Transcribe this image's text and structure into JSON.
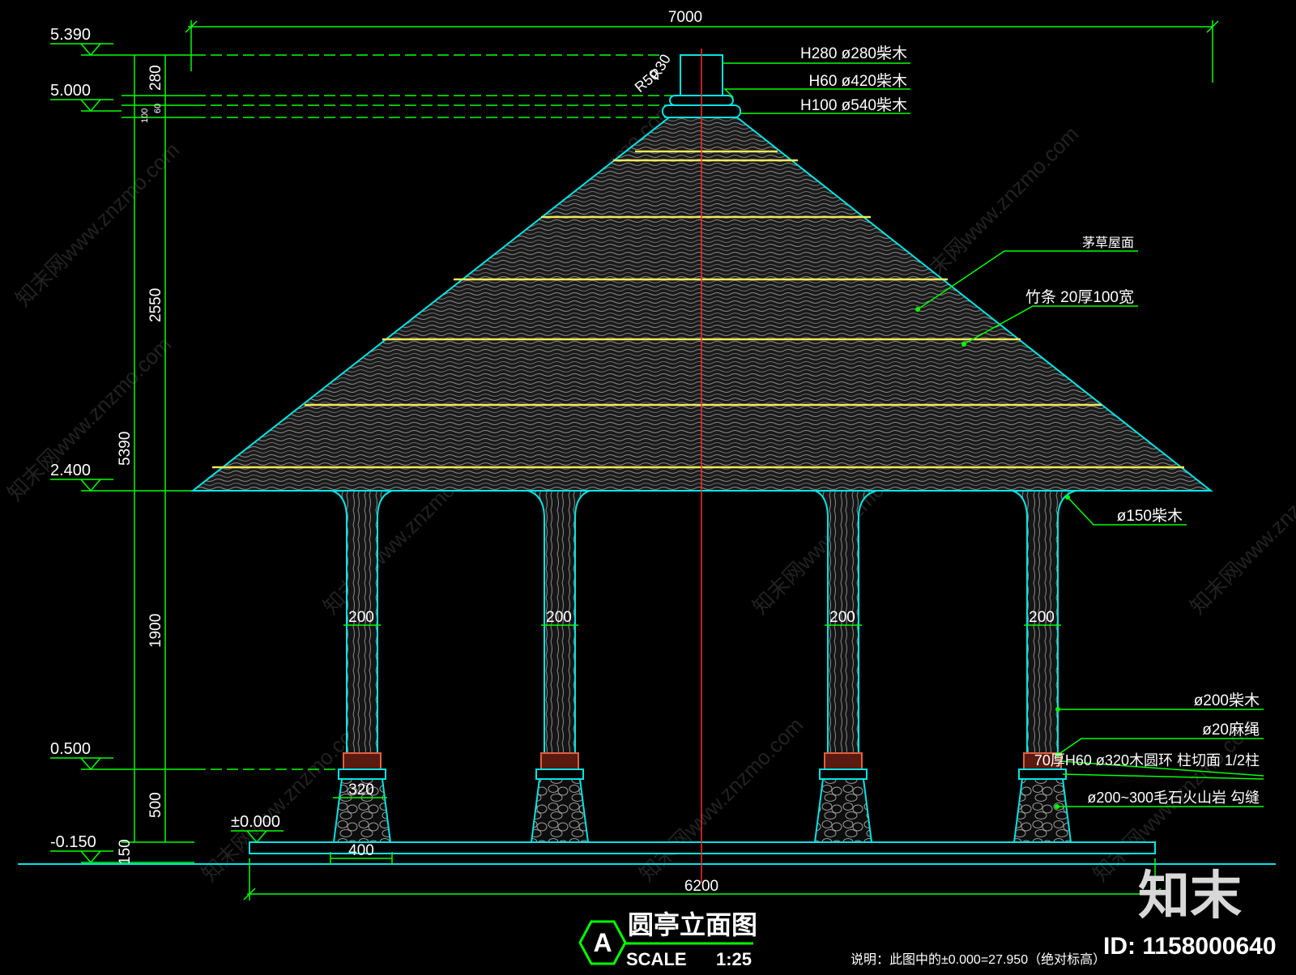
{
  "drawing": {
    "title": "圆亭立面图",
    "badge_letter": "A",
    "scale_label": "SCALE",
    "scale_value": "1:25",
    "note": "说明：此图中的±0.000=27.950（绝对标高）"
  },
  "dimensions": {
    "top_width": "7000",
    "bottom_width": "6200",
    "total_height": "5390",
    "roof_height": "2550",
    "column_height": "1900",
    "base_height": "500",
    "floor_thickness": "150",
    "cap_280": "280",
    "cap_60": "60",
    "cap_100": "100",
    "base_width": "400",
    "ring_width": "320",
    "column_dia": "200",
    "radius_r30": "R30",
    "radius_r50": "R50"
  },
  "elevations": [
    "5.390",
    "5.000",
    "2.400",
    "0.500",
    "±0.000",
    "-0.150"
  ],
  "annotations": {
    "cap_top": "H280  ø280柴木",
    "cap_mid": "H60  ø420柴木",
    "cap_bottom": "H100  ø540柴木",
    "roof_surface": "茅草屋面",
    "roof_batten": "竹条 20厚100宽",
    "bracket": "ø150柴木",
    "column": "ø200柴木",
    "rope": "ø20麻绳",
    "ring": "70厚H60  ø320木圆环  柱切面  1/2柱",
    "stone_base": "ø200~300毛石火山岩  勾缝"
  },
  "watermarks": [
    "知末网www.znzmo.com"
  ],
  "brand": {
    "logo": "知末",
    "id_label": "ID: 1158000640"
  },
  "colors": {
    "background": "#000000",
    "dimension": "#00ff00",
    "outline": "#00e5e5",
    "batten": "#f2e85a",
    "centerline": "#ff2a2a",
    "ring": "#e06040",
    "text": "#ffffff"
  }
}
